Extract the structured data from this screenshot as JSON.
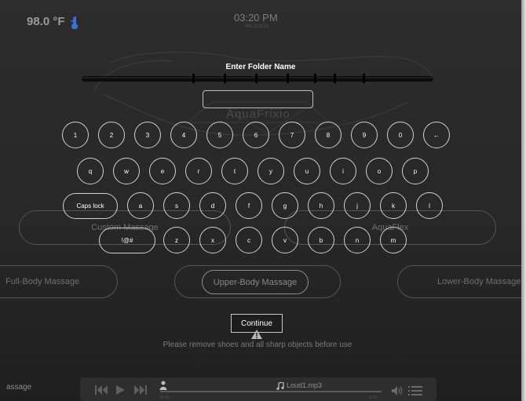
{
  "header": {
    "temperature": "98.0 °F",
    "time": "03:20 PM",
    "date": "06/13/2025"
  },
  "brand": "AquaFrixio",
  "background_buttons": {
    "custom": "Custom Massage",
    "aqua": "AquaFlex",
    "full": "Full-Body Massage",
    "upper": "Upper-Body Massage",
    "lower": "Lower-Body Massage"
  },
  "dialog": {
    "title": "Enter Folder Name",
    "input_value": "",
    "input_placeholder": "",
    "continue": "Continue"
  },
  "keyboard": {
    "row1": [
      "1",
      "2",
      "3",
      "4",
      "5",
      "6",
      "7",
      "8",
      "9",
      "0",
      "←"
    ],
    "row2": [
      "q",
      "w",
      "e",
      "r",
      "t",
      "y",
      "u",
      "i",
      "o",
      "p"
    ],
    "caps": "Caps lock",
    "row3": [
      "a",
      "s",
      "d",
      "f",
      "g",
      "h",
      "j",
      "k",
      "l"
    ],
    "symbols": "!@#",
    "row4": [
      "z",
      "x",
      "c",
      "v",
      "b",
      "n",
      "m"
    ]
  },
  "warning": "Please remove shoes and all sharp objects before use",
  "player": {
    "left_label": "assage",
    "track": "Loud1.mp3",
    "current": "00:00",
    "duration": "4:10"
  },
  "colors": {
    "background": "#2a2a2a",
    "key_border": "#d0d0d0",
    "temp_icon": "#3b6fd6"
  }
}
